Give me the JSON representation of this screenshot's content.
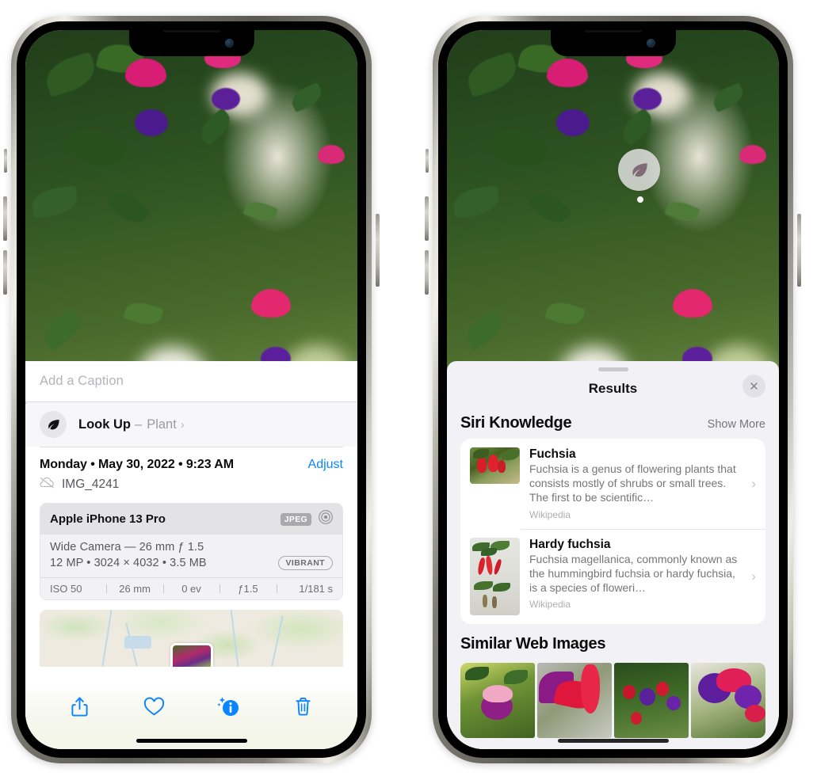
{
  "left_phone": {
    "caption": {
      "placeholder": "Add a Caption",
      "value": ""
    },
    "look_up": {
      "icon": "leaf-icon",
      "label": "Look Up",
      "dash": "–",
      "subject": "Plant",
      "chevron": "›"
    },
    "meta": {
      "date": "Monday • May 30, 2022 • 9:23 AM",
      "adjust_label": "Adjust",
      "cloud_icon": "cloud-slash-icon",
      "filename": "IMG_4241"
    },
    "exif": {
      "device": "Apple iPhone 13 Pro",
      "format_tag": "JPEG",
      "aperture_icon": "aperture-icon",
      "lens_line": "Wide Camera — 26 mm ƒ 1.5",
      "spec_line": "12 MP • 3024 × 4032 • 3.5 MB",
      "style_tag": "VIBRANT",
      "settings": [
        "ISO 50",
        "26 mm",
        "0 ev",
        "ƒ1.5",
        "1/181 s"
      ]
    },
    "map": {
      "name": "photo-location-map",
      "pin": "photo-pin"
    },
    "toolbar": [
      {
        "name": "share-icon",
        "label": "Share"
      },
      {
        "name": "heart-icon",
        "label": "Favorite"
      },
      {
        "name": "info-sparkle-icon",
        "label": "Info"
      },
      {
        "name": "trash-icon",
        "label": "Delete"
      }
    ]
  },
  "right_phone": {
    "vlu_badge": {
      "icon": "leaf-icon",
      "label": "Visual Look Up"
    },
    "sheet": {
      "title": "Results",
      "close_label": "✕",
      "sections": [
        {
          "title": "Siri Knowledge",
          "action": "Show More",
          "items": [
            {
              "title": "Fuchsia",
              "description": "Fuchsia is a genus of flowering plants that consists mostly of shrubs or small trees. The first to be scientific…",
              "source": "Wikipedia",
              "chevron": "›"
            },
            {
              "title": "Hardy fuchsia",
              "description": "Fuchsia magellanica, commonly known as the hummingbird fuchsia or hardy fuchsia, is a species of floweri…",
              "source": "Wikipedia",
              "chevron": "›"
            }
          ]
        },
        {
          "title": "Similar Web Images",
          "images": [
            "web-image-1",
            "web-image-2",
            "web-image-3",
            "web-image-4"
          ]
        }
      ]
    }
  },
  "colors": {
    "accent_blue": "#0a84ff",
    "sheet_bg": "#f2f1f6",
    "card_bg": "#ffffff",
    "secondary_text": "#767679"
  }
}
